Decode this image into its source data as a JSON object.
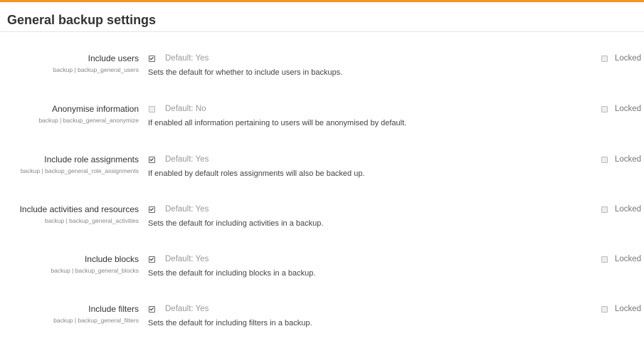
{
  "section": {
    "title": "General backup settings"
  },
  "settings": [
    {
      "label": "Include users",
      "key": "backup | backup_general_users",
      "checked": true,
      "default": "Default: Yes",
      "description": "Sets the default for whether to include users in backups.",
      "locked_label": "Locked"
    },
    {
      "label": "Anonymise information",
      "key": "backup | backup_general_anonymize",
      "checked": false,
      "default": "Default: No",
      "description": "If enabled all information pertaining to users will be anonymised by default.",
      "locked_label": "Locked"
    },
    {
      "label": "Include role assignments",
      "key": "backup | backup_general_role_assignments",
      "checked": true,
      "default": "Default: Yes",
      "description": "If enabled by default roles assignments will also be backed up.",
      "locked_label": "Locked"
    },
    {
      "label": "Include activities and resources",
      "key": "backup | backup_general_activities",
      "checked": true,
      "default": "Default: Yes",
      "description": "Sets the default for including activities in a backup.",
      "locked_label": "Locked"
    },
    {
      "label": "Include blocks",
      "key": "backup | backup_general_blocks",
      "checked": true,
      "default": "Default: Yes",
      "description": "Sets the default for including blocks in a backup.",
      "locked_label": "Locked"
    },
    {
      "label": "Include filters",
      "key": "backup | backup_general_filters",
      "checked": true,
      "default": "Default: Yes",
      "description": "Sets the default for including filters in a backup.",
      "locked_label": "Locked"
    }
  ],
  "colors": {
    "accent": "#f7941d"
  }
}
